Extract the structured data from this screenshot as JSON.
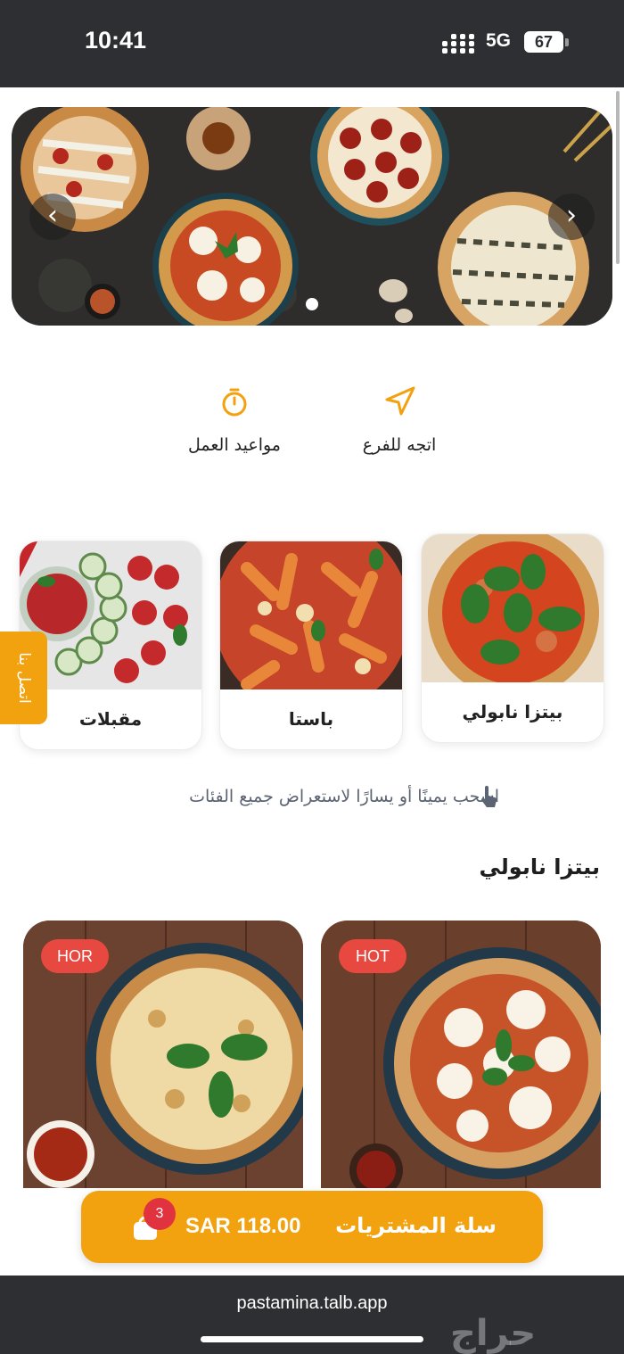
{
  "status_bar": {
    "time": "10:41",
    "network": "5G",
    "battery": "67"
  },
  "hero": {
    "prev_icon": "‹",
    "next_icon": "›",
    "slide_count": 1,
    "active_slide": 1
  },
  "actions": {
    "hours": {
      "label": "مواعيد العمل",
      "icon": "clock-icon"
    },
    "branch": {
      "label": "اتجه للفرع",
      "icon": "navigation-arrow-icon"
    }
  },
  "categories": [
    {
      "label": "بيتزا نابولي"
    },
    {
      "label": "باستا"
    },
    {
      "label": "مقبلات"
    }
  ],
  "contact_tab": {
    "label": "اتصل بنا"
  },
  "swipe_hint": "اسحب يمينًا أو يسارًا لاستعراض جميع الفئات",
  "section_title": "بيتزا نابولي",
  "products": [
    {
      "badge": "HOT"
    },
    {
      "badge": "HOR"
    }
  ],
  "cart": {
    "label": "سلة المشتريات",
    "total": "SAR 118.00",
    "count": "3"
  },
  "browser": {
    "url": "pastamina.talb.app"
  },
  "watermark": "حراج",
  "colors": {
    "accent": "#f2a10f",
    "badge": "#e7483f",
    "cart_count": "#e1323f",
    "bars": "#2d2f33"
  }
}
